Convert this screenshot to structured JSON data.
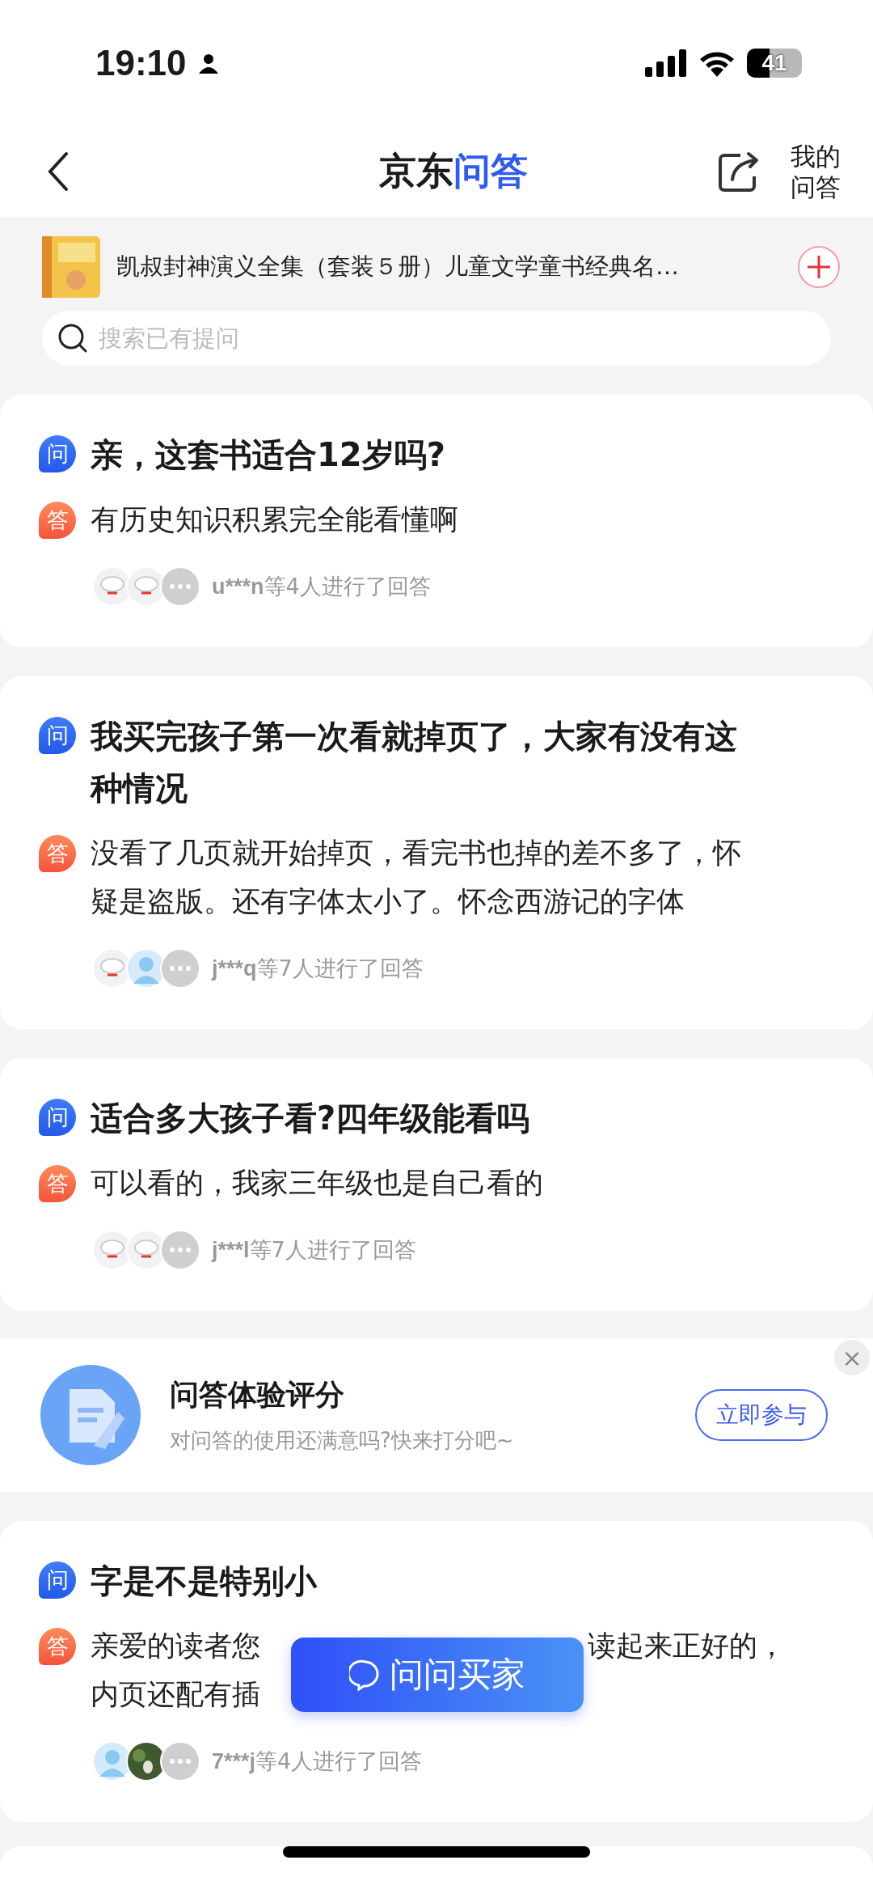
{
  "status_bar": {
    "time": "19:10",
    "battery": "41"
  },
  "nav": {
    "logo_brand": "京东",
    "logo_product": "问答",
    "my_qa": "我的问答"
  },
  "product": {
    "title": "凯叔封神演义全集（套装５册）儿童文学童书经典名…"
  },
  "search": {
    "placeholder": "搜索已有提问"
  },
  "questions": [
    {
      "q_badge": "问",
      "a_badge": "答",
      "question": "亲，这套书适合12岁吗?",
      "answer_lines": [
        [
          "有历史知识积累完全能看懂啊"
        ]
      ],
      "avatars": [
        {
          "kind": "robot"
        },
        {
          "kind": "robot"
        },
        {
          "kind": "more"
        }
      ],
      "summary_user": "u***n",
      "summary_text": "等4人进行了回答"
    },
    {
      "q_badge": "问",
      "a_badge": "答",
      "question": "我买完孩子第一次看就掉页了，大家有没有这种情况",
      "answer_lines": [
        [
          "没看了几页就开始掉页，看完书也掉的差不多了，怀疑是盗版。还有字体太小了。怀念西游记的字体"
        ]
      ],
      "avatars": [
        {
          "kind": "robot"
        },
        {
          "kind": "person"
        },
        {
          "kind": "more"
        }
      ],
      "summary_user": "j***q",
      "summary_text": "等7人进行了回答"
    },
    {
      "q_badge": "问",
      "a_badge": "答",
      "question": "适合多大孩子看?四年级能看吗",
      "answer_lines": [
        [
          "可以看的，我家三年级也是自己看的"
        ]
      ],
      "avatars": [
        {
          "kind": "robot"
        },
        {
          "kind": "robot"
        },
        {
          "kind": "more"
        }
      ],
      "summary_user": "j***l",
      "summary_text": "等7人进行了回答"
    },
    {
      "kind": "survey",
      "title": "问答体验评分",
      "subtitle": "对问答的使用还满意吗?快来打分吧~",
      "button": "立即参与",
      "close": "×"
    },
    {
      "q_badge": "问",
      "a_badge": "答",
      "question": "字是不是特别小",
      "answer_lines": [
        [
          "亲爱的读者您",
          "读起来正好的，"
        ],
        [
          "内页还配有插"
        ]
      ],
      "avatars": [
        {
          "kind": "person"
        },
        {
          "kind": "photo"
        },
        {
          "kind": "more"
        }
      ],
      "summary_user": "7***j",
      "summary_text": "等4人进行了回答"
    }
  ],
  "ask_button": {
    "label": "问问买家"
  }
}
